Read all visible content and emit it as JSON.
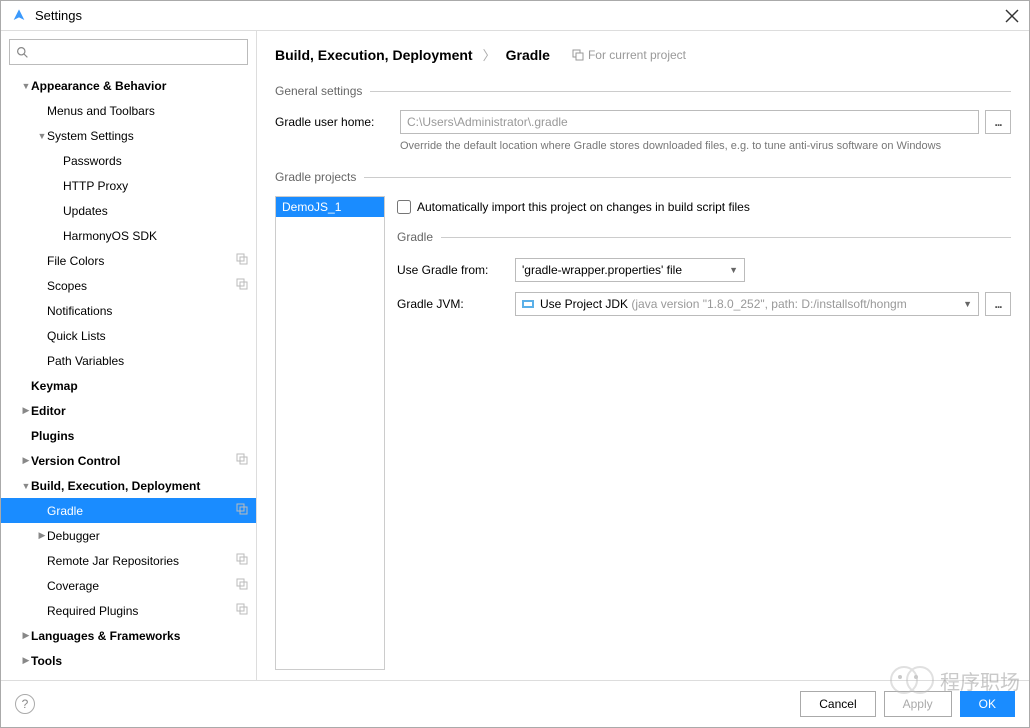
{
  "title": "Settings",
  "breadcrumb": {
    "path": [
      "Build, Execution, Deployment",
      "Gradle"
    ],
    "scope": "For current project"
  },
  "sidebar": {
    "items": [
      {
        "label": "Appearance & Behavior",
        "bold": true,
        "arrow": "down",
        "pad": 0
      },
      {
        "label": "Menus and Toolbars",
        "pad": 1
      },
      {
        "label": "System Settings",
        "arrow": "down",
        "pad": 1
      },
      {
        "label": "Passwords",
        "pad": 2
      },
      {
        "label": "HTTP Proxy",
        "pad": 2
      },
      {
        "label": "Updates",
        "pad": 2
      },
      {
        "label": "HarmonyOS SDK",
        "pad": 2
      },
      {
        "label": "File Colors",
        "pad": 1,
        "badge": true
      },
      {
        "label": "Scopes",
        "pad": 1,
        "badge": true
      },
      {
        "label": "Notifications",
        "pad": 1
      },
      {
        "label": "Quick Lists",
        "pad": 1
      },
      {
        "label": "Path Variables",
        "pad": 1
      },
      {
        "label": "Keymap",
        "bold": true,
        "pad": 0
      },
      {
        "label": "Editor",
        "bold": true,
        "arrow": "right",
        "pad": 0
      },
      {
        "label": "Plugins",
        "bold": true,
        "pad": 0
      },
      {
        "label": "Version Control",
        "bold": true,
        "arrow": "right",
        "pad": 0,
        "badge": true
      },
      {
        "label": "Build, Execution, Deployment",
        "bold": true,
        "arrow": "down",
        "pad": 0
      },
      {
        "label": "Gradle",
        "pad": 1,
        "selected": true,
        "badge": true
      },
      {
        "label": "Debugger",
        "arrow": "right",
        "pad": 1
      },
      {
        "label": "Remote Jar Repositories",
        "pad": 1,
        "badge": true
      },
      {
        "label": "Coverage",
        "pad": 1,
        "badge": true
      },
      {
        "label": "Required Plugins",
        "pad": 1,
        "badge": true
      },
      {
        "label": "Languages & Frameworks",
        "bold": true,
        "arrow": "right",
        "pad": 0
      },
      {
        "label": "Tools",
        "bold": true,
        "arrow": "right",
        "pad": 0
      }
    ]
  },
  "general": {
    "legend": "General settings",
    "home_label": "Gradle user home:",
    "home_value": "C:\\Users\\Administrator\\.gradle",
    "home_hint": "Override the default location where Gradle stores downloaded files, e.g. to tune anti-virus software on Windows"
  },
  "projects": {
    "legend": "Gradle projects",
    "list": [
      "DemoJS_1"
    ],
    "auto_import_label": "Automatically import this project on changes in build script files",
    "gradle_legend": "Gradle",
    "use_from_label": "Use Gradle from:",
    "use_from_value": "'gradle-wrapper.properties' file",
    "jvm_label": "Gradle JVM:",
    "jvm_value_main": "Use Project JDK",
    "jvm_value_detail": " (java version \"1.8.0_252\", path: D:/installsoft/hongm"
  },
  "buttons": {
    "cancel": "Cancel",
    "apply": "Apply",
    "ok": "OK"
  },
  "watermark": "程序职场"
}
